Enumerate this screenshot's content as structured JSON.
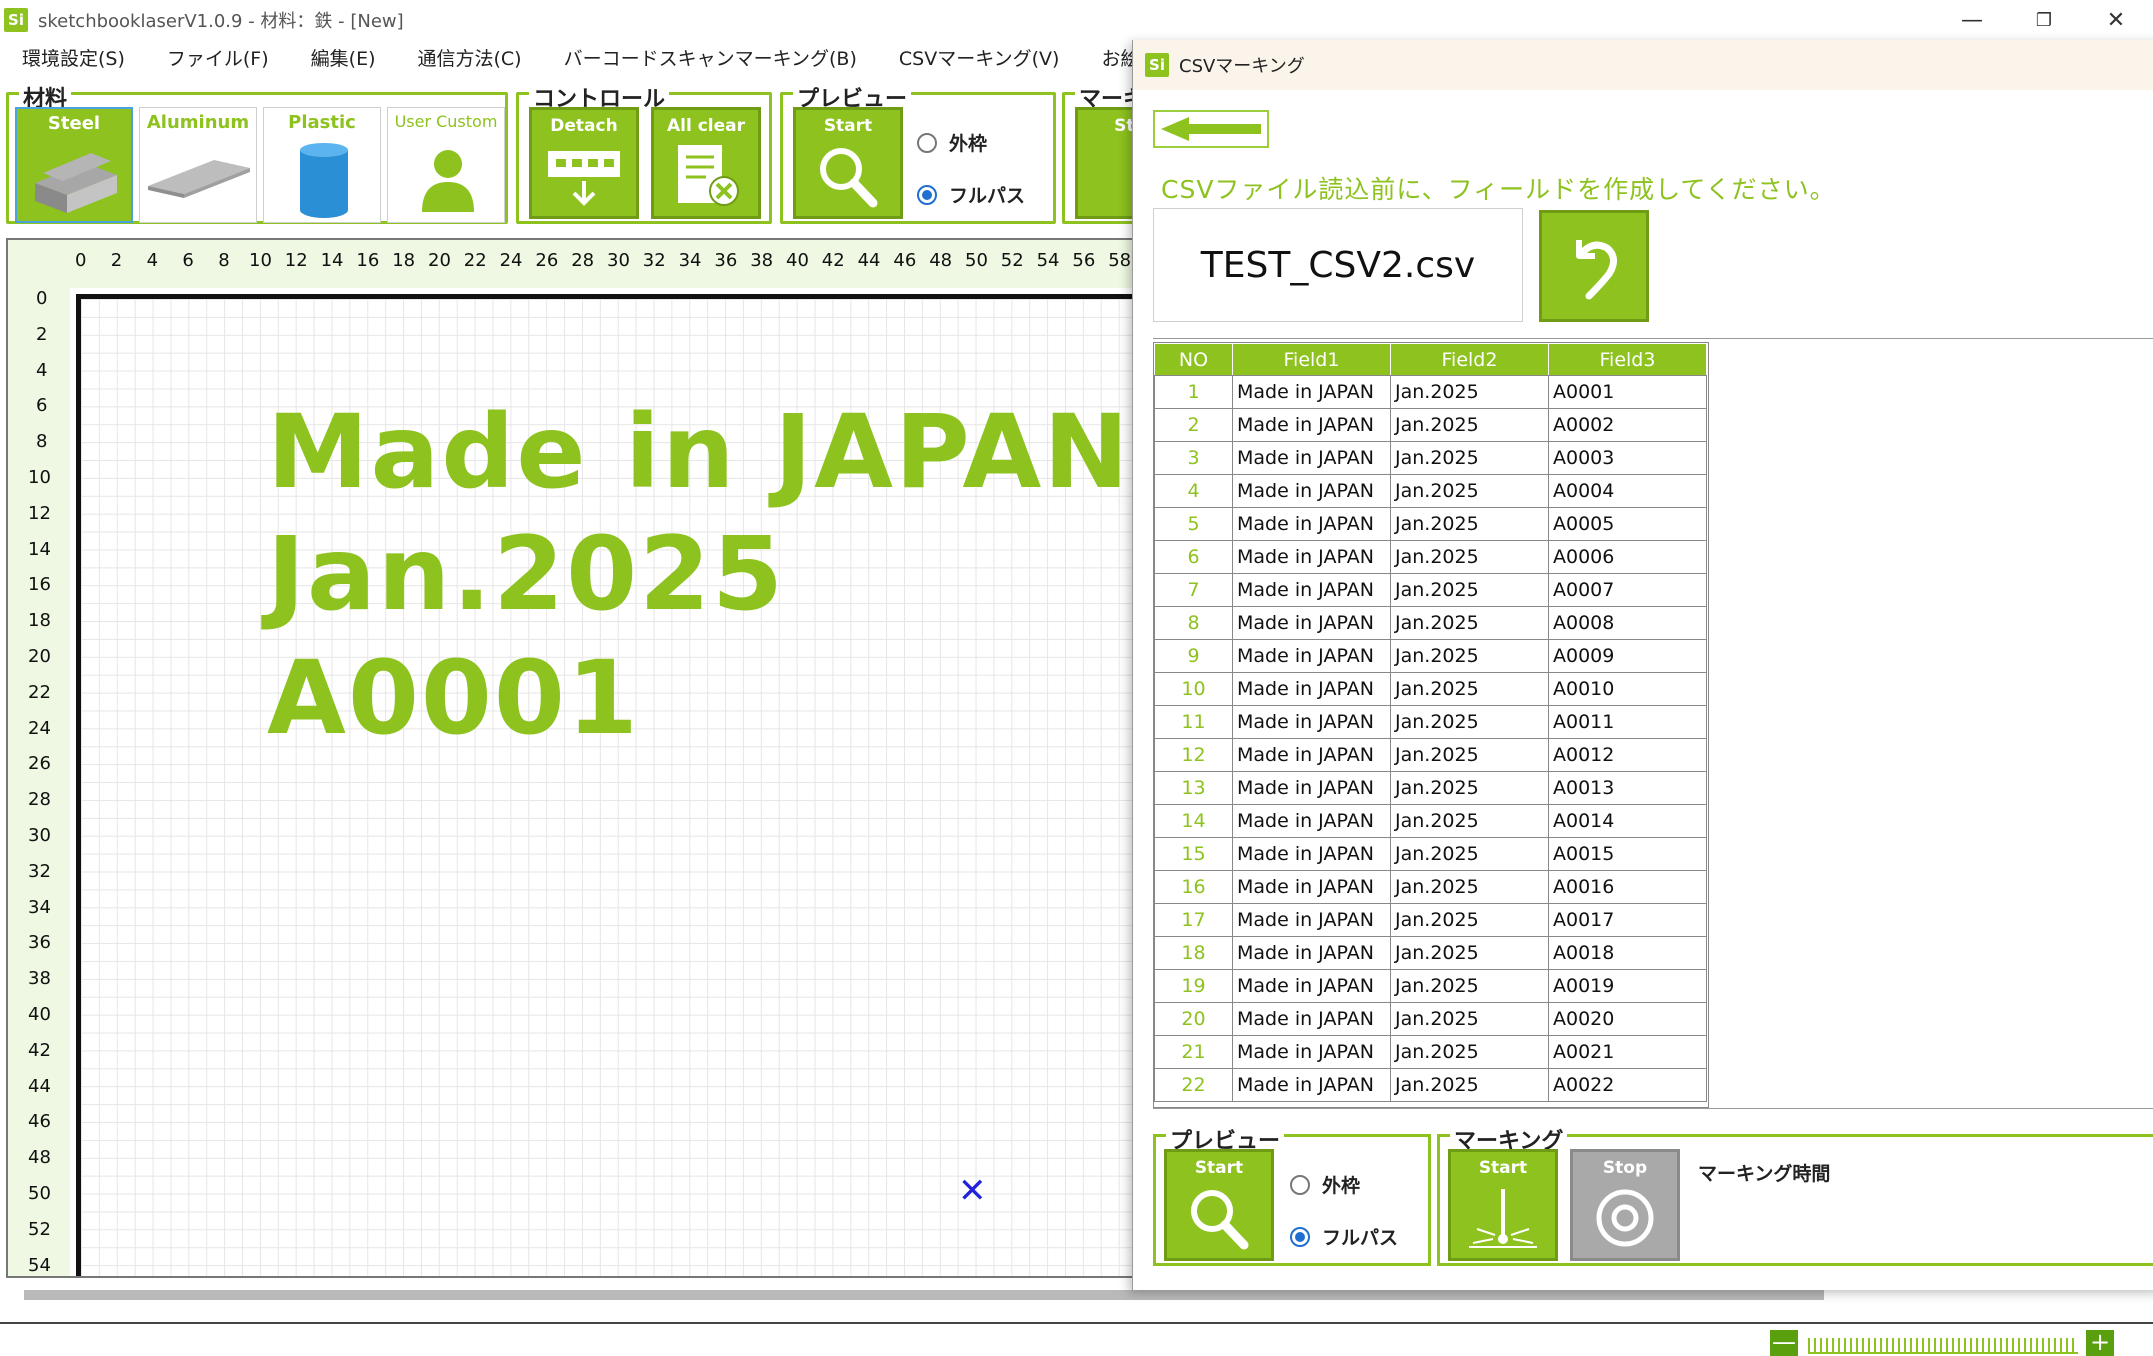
{
  "app": {
    "logo": "Si",
    "title": "sketchbooklaserV1.0.9 - 材料：鉄 - [New]",
    "window_controls": [
      "—",
      "❐",
      "✕"
    ]
  },
  "menu": [
    "環境設定(S)",
    "ファイル(F)",
    "編集(E)",
    "通信方法(C)",
    "バーコードスキャンマーキング(B)",
    "CSVマーキング(V)",
    "お絵描き編集(T"
  ],
  "ribbon": {
    "materials": {
      "title": "材料",
      "items": [
        {
          "label": "Steel",
          "icon": "steel-bars-icon",
          "selected": true
        },
        {
          "label": "Aluminum",
          "icon": "aluminum-sheet-icon",
          "selected": false
        },
        {
          "label": "Plastic",
          "icon": "plastic-cylinder-icon",
          "selected": false
        },
        {
          "label": "User Custom",
          "icon": "user-icon",
          "selected": false
        }
      ]
    },
    "control": {
      "title": "コントロール",
      "detach_label": "Detach",
      "allclear_label": "All clear"
    },
    "preview": {
      "title": "プレビュー",
      "start_label": "Start",
      "option_outer": "外枠",
      "option_fullpath": "フルパス",
      "selected": "フルパス"
    },
    "marking": {
      "title": "マーキ",
      "start_label": "Sta"
    }
  },
  "canvas": {
    "ruler_x": [
      "0",
      "2",
      "4",
      "6",
      "8",
      "10",
      "12",
      "14",
      "16",
      "18",
      "20",
      "22",
      "24",
      "26",
      "28",
      "30",
      "32",
      "34",
      "36",
      "38",
      "40",
      "42",
      "44",
      "46",
      "48",
      "50",
      "52",
      "54",
      "56",
      "58"
    ],
    "ruler_y": [
      "0",
      "2",
      "4",
      "6",
      "8",
      "10",
      "12",
      "14",
      "16",
      "18",
      "20",
      "22",
      "24",
      "26",
      "28",
      "30",
      "32",
      "34",
      "36",
      "38",
      "40",
      "42",
      "44",
      "46",
      "48",
      "50",
      "52",
      "54"
    ],
    "text_lines": [
      "Made in JAPAN",
      "Jan.2025",
      "A0001"
    ],
    "cross_marker": "✕",
    "colors": {
      "accent": "#8dc21f",
      "marker": "#2222dd"
    }
  },
  "zoom": {
    "minus": "—",
    "plus": "+"
  },
  "csv_dialog": {
    "logo": "Si",
    "title": "CSVマーキング",
    "instruction": "CSVファイル読込前に、フィールドを作成してください。",
    "filename": "TEST_CSV2.csv",
    "table": {
      "headers": [
        "NO",
        "Field1",
        "Field2",
        "Field3"
      ],
      "rows": [
        [
          "1",
          "Made in JAPAN",
          "Jan.2025",
          "A0001"
        ],
        [
          "2",
          "Made in JAPAN",
          "Jan.2025",
          "A0002"
        ],
        [
          "3",
          "Made in JAPAN",
          "Jan.2025",
          "A0003"
        ],
        [
          "4",
          "Made in JAPAN",
          "Jan.2025",
          "A0004"
        ],
        [
          "5",
          "Made in JAPAN",
          "Jan.2025",
          "A0005"
        ],
        [
          "6",
          "Made in JAPAN",
          "Jan.2025",
          "A0006"
        ],
        [
          "7",
          "Made in JAPAN",
          "Jan.2025",
          "A0007"
        ],
        [
          "8",
          "Made in JAPAN",
          "Jan.2025",
          "A0008"
        ],
        [
          "9",
          "Made in JAPAN",
          "Jan.2025",
          "A0009"
        ],
        [
          "10",
          "Made in JAPAN",
          "Jan.2025",
          "A0010"
        ],
        [
          "11",
          "Made in JAPAN",
          "Jan.2025",
          "A0011"
        ],
        [
          "12",
          "Made in JAPAN",
          "Jan.2025",
          "A0012"
        ],
        [
          "13",
          "Made in JAPAN",
          "Jan.2025",
          "A0013"
        ],
        [
          "14",
          "Made in JAPAN",
          "Jan.2025",
          "A0014"
        ],
        [
          "15",
          "Made in JAPAN",
          "Jan.2025",
          "A0015"
        ],
        [
          "16",
          "Made in JAPAN",
          "Jan.2025",
          "A0016"
        ],
        [
          "17",
          "Made in JAPAN",
          "Jan.2025",
          "A0017"
        ],
        [
          "18",
          "Made in JAPAN",
          "Jan.2025",
          "A0018"
        ],
        [
          "19",
          "Made in JAPAN",
          "Jan.2025",
          "A0019"
        ],
        [
          "20",
          "Made in JAPAN",
          "Jan.2025",
          "A0020"
        ],
        [
          "21",
          "Made in JAPAN",
          "Jan.2025",
          "A0021"
        ],
        [
          "22",
          "Made in JAPAN",
          "Jan.2025",
          "A0022"
        ]
      ]
    },
    "preview": {
      "title": "プレビュー",
      "start_label": "Start",
      "option_outer": "外枠",
      "option_fullpath": "フルパス",
      "selected": "フルパス"
    },
    "marking": {
      "title": "マーキング",
      "start_label": "Start",
      "stop_label": "Stop",
      "time_label": "マーキング時間"
    }
  }
}
